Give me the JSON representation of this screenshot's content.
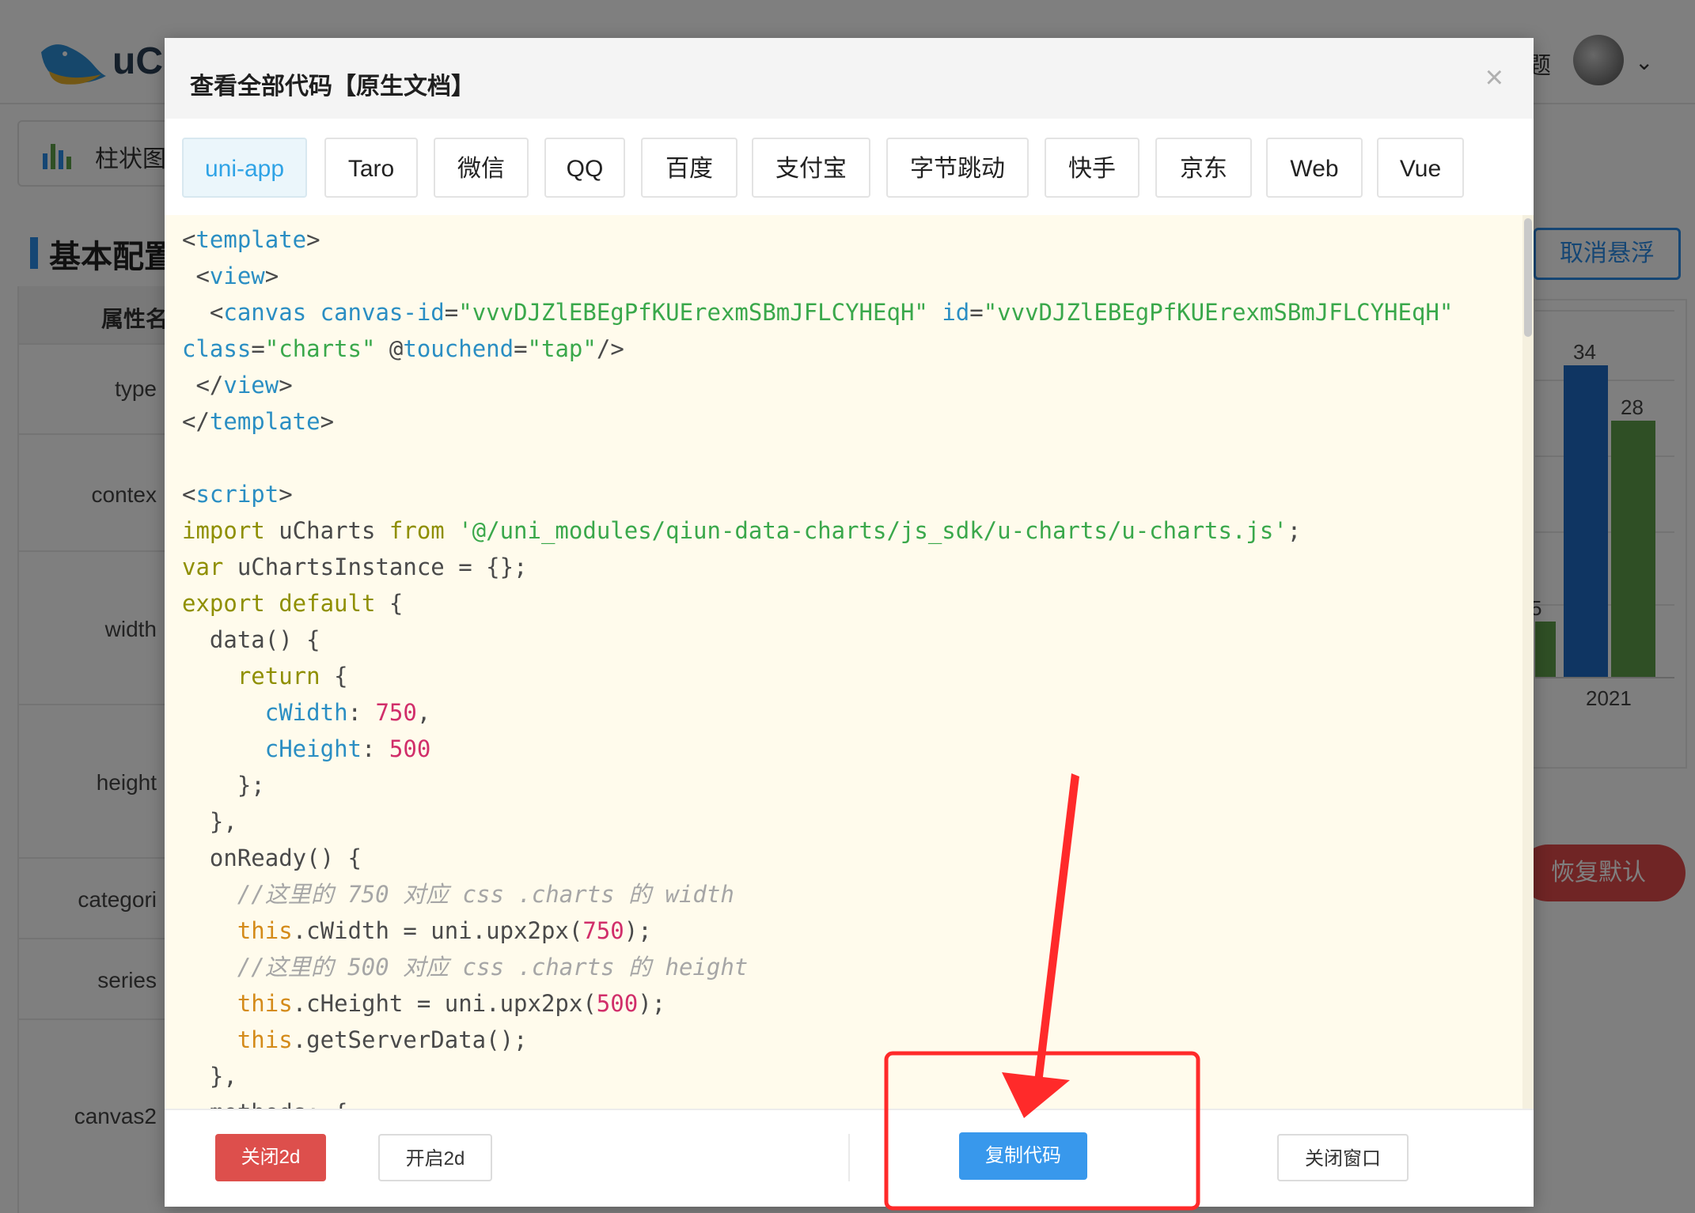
{
  "background": {
    "logo_text": "uCh",
    "header_right_text": "题",
    "chart_tab_label": "柱状图",
    "section_title": "基本配置",
    "table_header": "属性名",
    "row_labels": [
      "type",
      "contex",
      "width",
      "height",
      "categori",
      "series",
      "canvas2"
    ],
    "cancel_float_label": "取消悬浮",
    "restore_label": "恢复默认",
    "chart": {
      "bar_labels": [
        "34",
        "28"
      ],
      "x_label": "2021",
      "partial_label": "5",
      "colors": {
        "blue": "#1f6bc5",
        "green": "#5f9e4a"
      }
    }
  },
  "modal": {
    "title": "查看全部代码【原生文档】",
    "close_icon": "×",
    "tabs": [
      {
        "label": "uni-app",
        "active": true
      },
      {
        "label": "Taro"
      },
      {
        "label": "微信"
      },
      {
        "label": "QQ"
      },
      {
        "label": "百度"
      },
      {
        "label": "支付宝"
      },
      {
        "label": "字节跳动"
      },
      {
        "label": "快手"
      },
      {
        "label": "京东"
      },
      {
        "label": "Web"
      },
      {
        "label": "Vue"
      }
    ],
    "code_lines": [
      [
        [
          "plain",
          "<"
        ],
        [
          "tag",
          "template"
        ],
        [
          "plain",
          ">"
        ]
      ],
      [
        [
          "plain",
          " <"
        ],
        [
          "tag",
          "view"
        ],
        [
          "plain",
          ">"
        ]
      ],
      [
        [
          "plain",
          "  <"
        ],
        [
          "tag",
          "canvas"
        ],
        [
          "plain",
          " "
        ],
        [
          "attr",
          "canvas-id"
        ],
        [
          "plain",
          "="
        ],
        [
          "str",
          "\"vvvDJZlEBEgPfKUErexmSBmJFLCYHEqH\""
        ],
        [
          "plain",
          " "
        ],
        [
          "attr",
          "id"
        ],
        [
          "plain",
          "="
        ],
        [
          "str",
          "\"vvvDJZlEBEgPfKUErexmSBmJFLCYHEqH\""
        ]
      ],
      [
        [
          "attr",
          "class"
        ],
        [
          "plain",
          "="
        ],
        [
          "str",
          "\"charts\""
        ],
        [
          "plain",
          " @"
        ],
        [
          "attr",
          "touchend"
        ],
        [
          "plain",
          "="
        ],
        [
          "str",
          "\"tap\""
        ],
        [
          "plain",
          "/>"
        ]
      ],
      [
        [
          "plain",
          " </"
        ],
        [
          "tag",
          "view"
        ],
        [
          "plain",
          ">"
        ]
      ],
      [
        [
          "plain",
          "</"
        ],
        [
          "tag",
          "template"
        ],
        [
          "plain",
          ">"
        ]
      ],
      [
        [
          "plain",
          ""
        ]
      ],
      [
        [
          "plain",
          "<"
        ],
        [
          "tag",
          "script"
        ],
        [
          "plain",
          ">"
        ]
      ],
      [
        [
          "kw",
          "import"
        ],
        [
          "plain",
          " uCharts "
        ],
        [
          "kw",
          "from"
        ],
        [
          "plain",
          " "
        ],
        [
          "str",
          "'@/uni_modules/qiun-data-charts/js_sdk/u-charts/u-charts.js'"
        ],
        [
          "plain",
          ";"
        ]
      ],
      [
        [
          "kw",
          "var"
        ],
        [
          "plain",
          " uChartsInstance = {};"
        ]
      ],
      [
        [
          "kw",
          "export default"
        ],
        [
          "plain",
          " {"
        ]
      ],
      [
        [
          "plain",
          "  data() {"
        ]
      ],
      [
        [
          "plain",
          "    "
        ],
        [
          "kw",
          "return"
        ],
        [
          "plain",
          " {"
        ]
      ],
      [
        [
          "plain",
          "      "
        ],
        [
          "prop",
          "cWidth"
        ],
        [
          "plain",
          ": "
        ],
        [
          "num",
          "750"
        ],
        [
          "plain",
          ","
        ]
      ],
      [
        [
          "plain",
          "      "
        ],
        [
          "prop",
          "cHeight"
        ],
        [
          "plain",
          ": "
        ],
        [
          "num",
          "500"
        ]
      ],
      [
        [
          "plain",
          "    };"
        ]
      ],
      [
        [
          "plain",
          "  },"
        ]
      ],
      [
        [
          "plain",
          "  onReady() {"
        ]
      ],
      [
        [
          "plain",
          "    "
        ],
        [
          "comment",
          "//这里的 750 对应 css .charts 的 width"
        ]
      ],
      [
        [
          "plain",
          "    "
        ],
        [
          "this",
          "this"
        ],
        [
          "plain",
          ".cWidth = uni.upx2px("
        ],
        [
          "num",
          "750"
        ],
        [
          "plain",
          ");"
        ]
      ],
      [
        [
          "plain",
          "    "
        ],
        [
          "comment",
          "//这里的 500 对应 css .charts 的 height"
        ]
      ],
      [
        [
          "plain",
          "    "
        ],
        [
          "this",
          "this"
        ],
        [
          "plain",
          ".cHeight = uni.upx2px("
        ],
        [
          "num",
          "500"
        ],
        [
          "plain",
          ");"
        ]
      ],
      [
        [
          "plain",
          "    "
        ],
        [
          "this",
          "this"
        ],
        [
          "plain",
          ".getServerData();"
        ]
      ],
      [
        [
          "plain",
          "  },"
        ]
      ],
      [
        [
          "plain",
          "  methods: {"
        ]
      ]
    ],
    "footer": {
      "close_2d": "关闭2d",
      "open_2d": "开启2d",
      "copy_code": "复制代码",
      "close_window": "关闭窗口"
    }
  },
  "colors": {
    "accent": "#3898ec",
    "danger": "#dd4f4c",
    "annotation": "#ff2a2a"
  }
}
